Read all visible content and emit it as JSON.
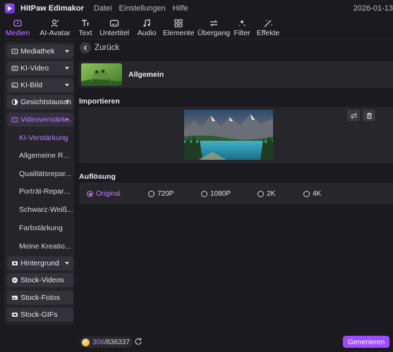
{
  "window": {
    "app_title": "HitPaw Edimakor",
    "menu": [
      "Datei",
      "Einstellungen",
      "Hilfe"
    ],
    "date": "2026-01-13"
  },
  "toolbar": {
    "tabs": [
      {
        "label": "Medien",
        "icon": "media-icon",
        "active": true
      },
      {
        "label": "AI-Avatar",
        "icon": "avatar-icon",
        "active": false
      },
      {
        "label": "Text",
        "icon": "text-icon",
        "active": false
      },
      {
        "label": "Untertitel",
        "icon": "subtitle-icon",
        "active": false
      },
      {
        "label": "Audio",
        "icon": "audio-icon",
        "active": false
      },
      {
        "label": "Elemente",
        "icon": "elements-icon",
        "active": false
      },
      {
        "label": "Übergang",
        "icon": "transition-icon",
        "active": false
      },
      {
        "label": "Filter",
        "icon": "filter-icon",
        "active": false
      },
      {
        "label": "Effekte",
        "icon": "effects-icon",
        "active": false
      }
    ]
  },
  "sidebar": {
    "items": [
      {
        "label": "Mediathek",
        "expandable": true
      },
      {
        "label": "KI-Video",
        "expandable": true
      },
      {
        "label": "KI-Bild",
        "expandable": true
      },
      {
        "label": "Gesichtstausch",
        "expandable": true
      },
      {
        "label": "Videoverstärk...",
        "expandable": true,
        "expanded": true,
        "active": true
      },
      {
        "label": "Hintergrund",
        "expandable": true
      },
      {
        "label": "Stock-Videos",
        "expandable": false
      },
      {
        "label": "Stock-Fotos",
        "expandable": false
      },
      {
        "label": "Stock-GIFs",
        "expandable": false
      }
    ],
    "subitems": [
      {
        "label": "KI-Verstärkung",
        "active": true
      },
      {
        "label": "Allgemeine R..."
      },
      {
        "label": "Qualitätsrepar..."
      },
      {
        "label": "Porträt-Repar..."
      },
      {
        "label": "Schwarz-Weiß..."
      },
      {
        "label": "Farbstärkung"
      },
      {
        "label": "Meine Kreatio..."
      }
    ]
  },
  "main": {
    "back_label": "Zurück",
    "general_label": "Allgemein",
    "import_title": "Importieren",
    "resolution_title": "Auflösung",
    "resolutions": [
      {
        "label": "Original",
        "selected": true
      },
      {
        "label": "720P"
      },
      {
        "label": "1080P"
      },
      {
        "label": "2K"
      },
      {
        "label": "4K"
      }
    ]
  },
  "bottom": {
    "credits_used": "306",
    "credits_total": "/836337",
    "generate_label": "Generieren"
  },
  "colors": {
    "accent": "#b77dff",
    "button": "#9b4dff",
    "background": "#1b1b1f",
    "panel": "#26262b"
  }
}
